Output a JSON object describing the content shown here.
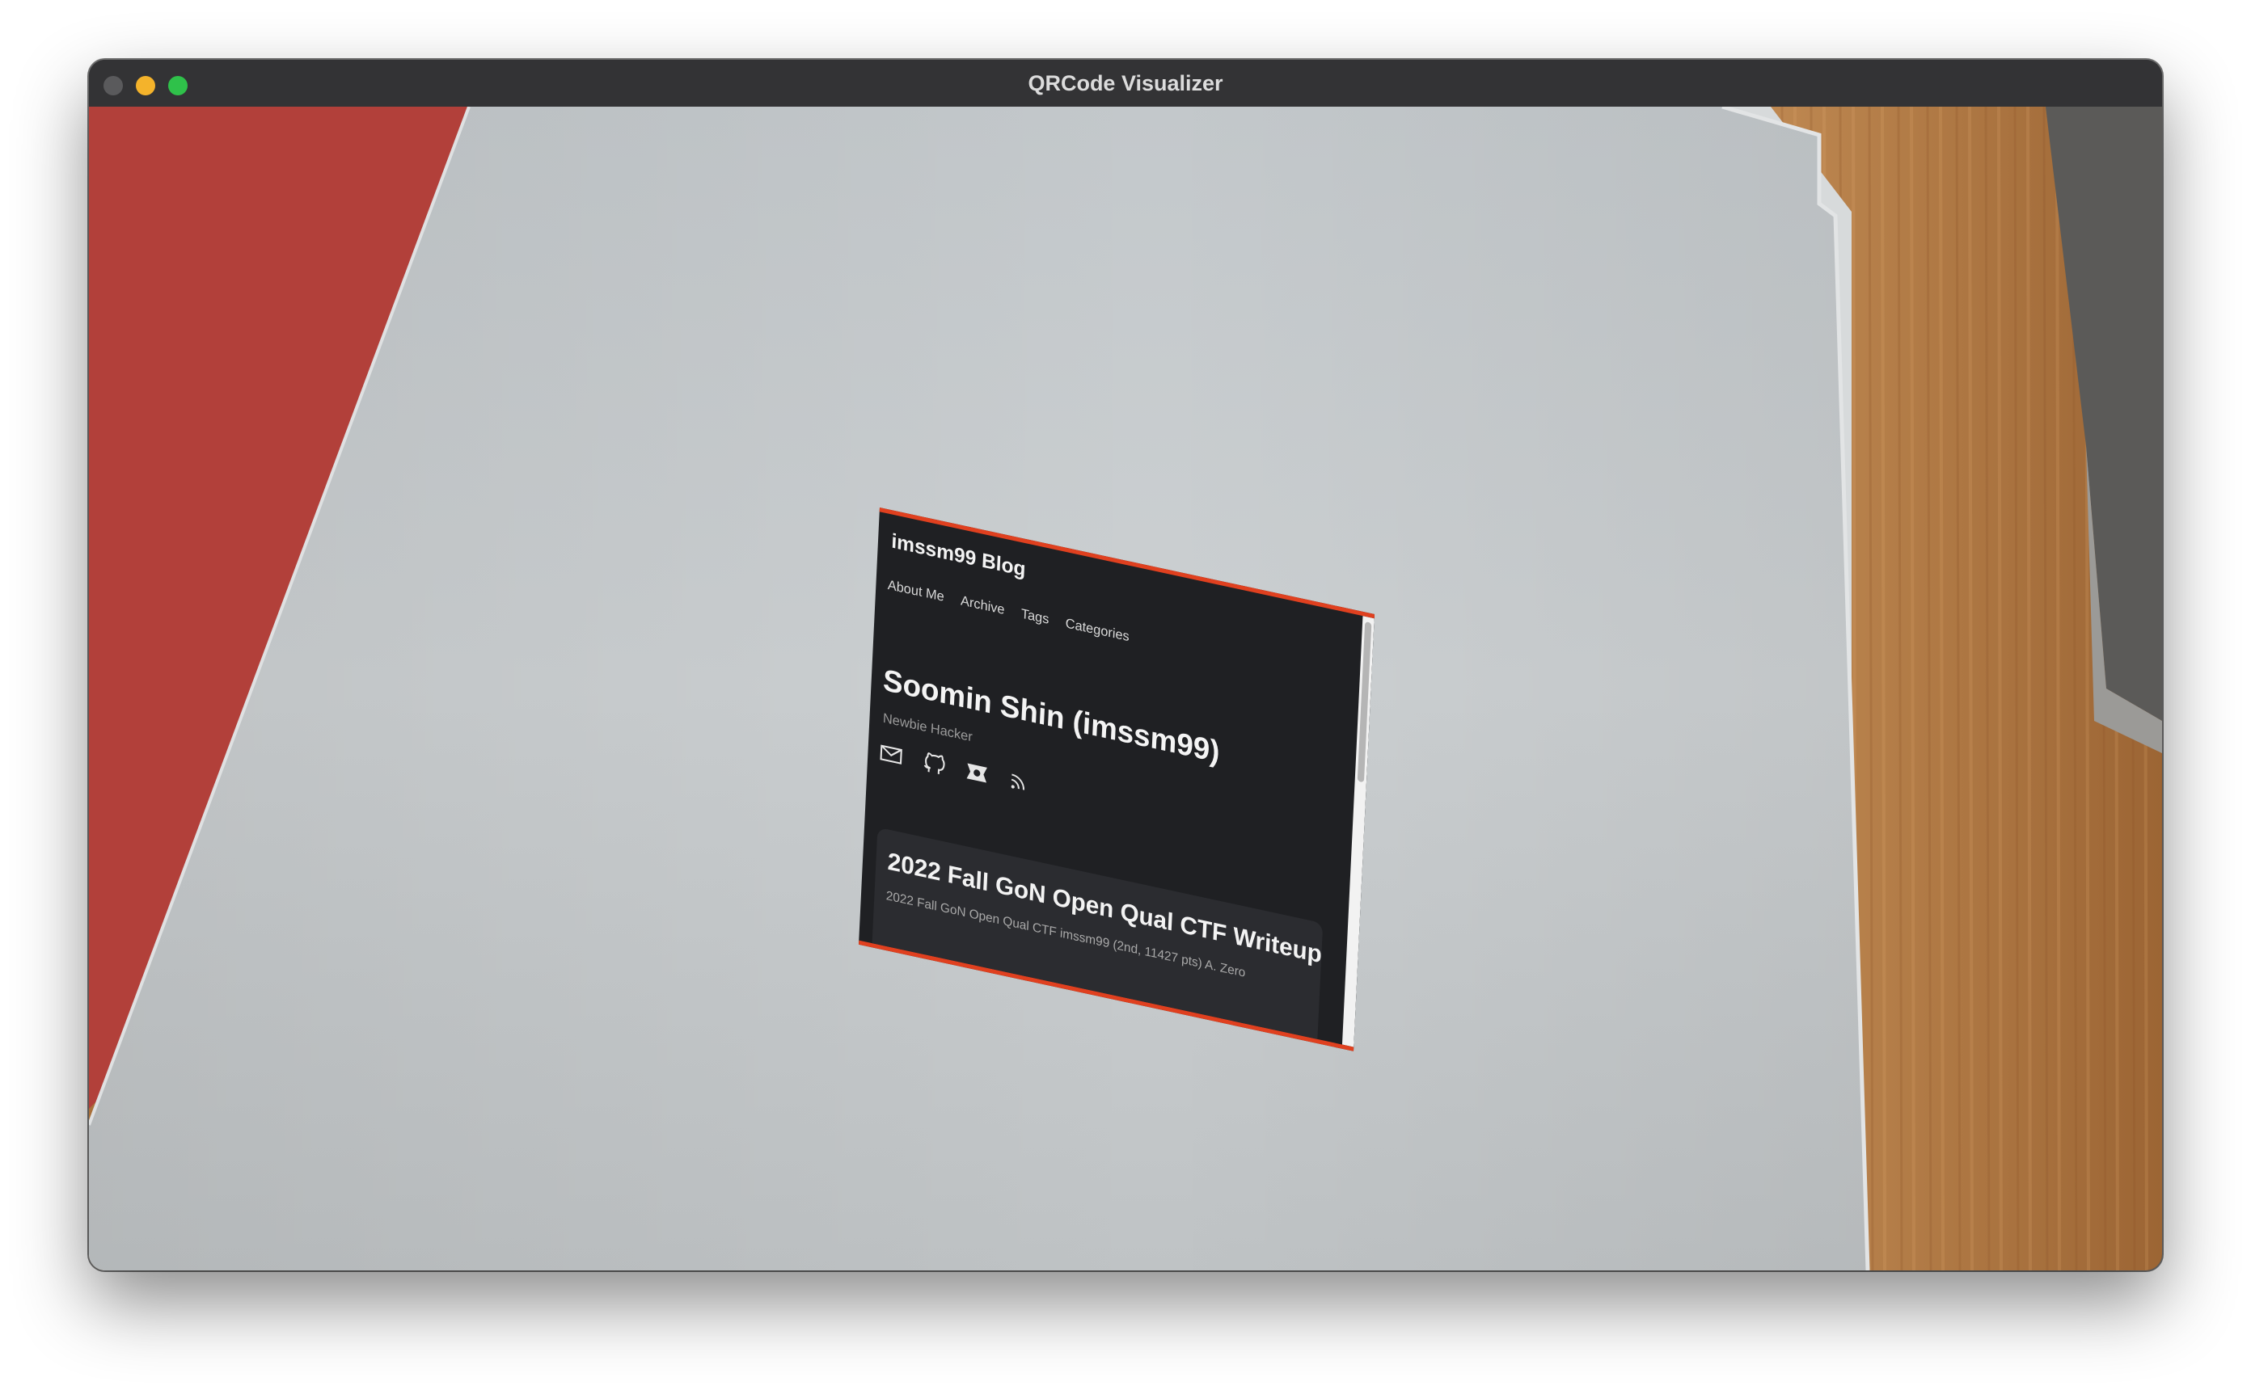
{
  "window": {
    "title": "QRCode Visualizer"
  },
  "overlay": {
    "blog_title": "imssm99 Blog",
    "nav": [
      "About Me",
      "Archive",
      "Tags",
      "Categories"
    ],
    "author_name": "Soomin Shin (imssm99)",
    "author_tagline": "Newbie Hacker",
    "social_icons": [
      "mail-icon",
      "github-icon",
      "ctf-icon",
      "rss-icon"
    ],
    "post": {
      "title": "2022 Fall GoN Open Qual CTF Writeup",
      "meta": "2022 Fall GoN Open Qual CTF imssm99 (2nd, 11427 pts) A. Zero"
    },
    "accent_color": "#e0401f"
  },
  "colors": {
    "titlebar": "#333335",
    "paper": "#c8ccce",
    "desk_wood": "#b3783e",
    "red_folder": "#b03a32"
  }
}
